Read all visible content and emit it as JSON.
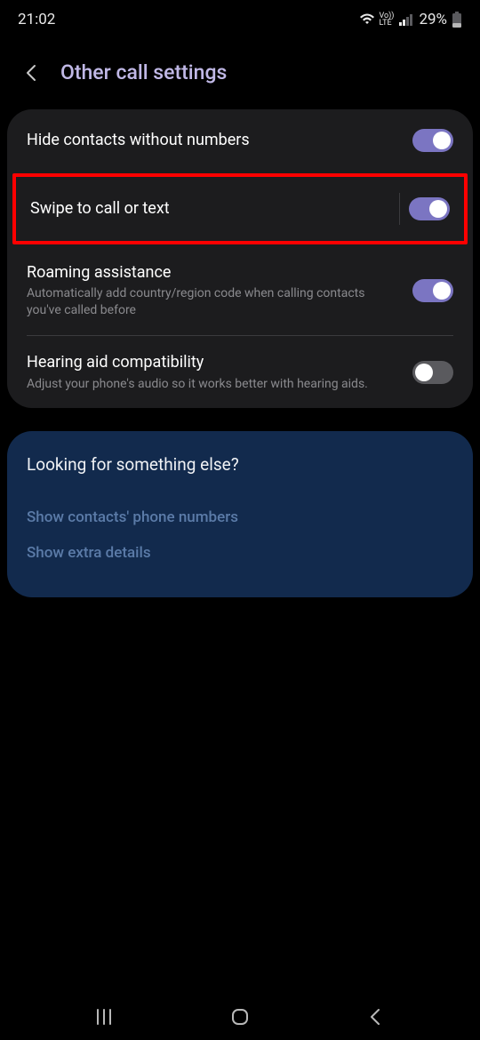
{
  "statusBar": {
    "time": "21:02",
    "battery": "29%"
  },
  "header": {
    "title": "Other call settings"
  },
  "settings": [
    {
      "title": "Hide contacts without numbers",
      "desc": "",
      "on": true,
      "hasDivider": false,
      "highlighted": false
    },
    {
      "title": "Swipe to call or text",
      "desc": "",
      "on": true,
      "hasDivider": true,
      "highlighted": true
    },
    {
      "title": "Roaming assistance",
      "desc": "Automatically add country/region code when calling contacts you've called before",
      "on": true,
      "hasDivider": false,
      "highlighted": false
    },
    {
      "title": "Hearing aid compatibility",
      "desc": "Adjust your phone's audio so it works better with hearing aids.",
      "on": false,
      "hasDivider": false,
      "highlighted": false
    }
  ],
  "blueCard": {
    "title": "Looking for something else?",
    "links": [
      "Show contacts' phone numbers",
      "Show extra details"
    ]
  }
}
